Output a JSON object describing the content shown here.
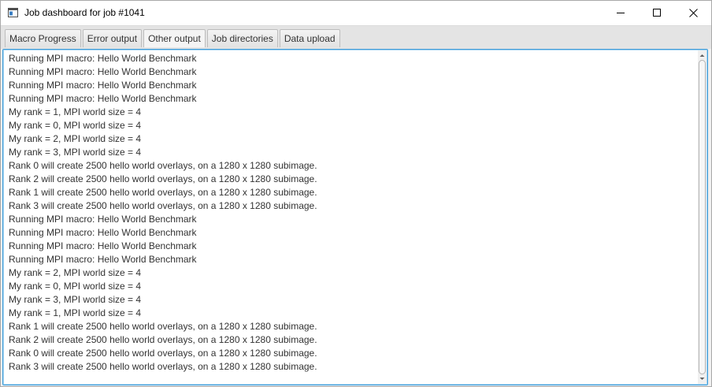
{
  "window": {
    "title": "Job dashboard for job #1041"
  },
  "tabs": [
    {
      "label": "Macro Progress",
      "selected": false
    },
    {
      "label": "Error output",
      "selected": false
    },
    {
      "label": "Other output",
      "selected": true
    },
    {
      "label": "Job directories",
      "selected": false
    },
    {
      "label": "Data upload",
      "selected": false
    }
  ],
  "output": {
    "lines": [
      "Running MPI macro: Hello World Benchmark",
      "Running MPI macro: Hello World Benchmark",
      "Running MPI macro: Hello World Benchmark",
      "Running MPI macro: Hello World Benchmark",
      "My rank = 1, MPI world size = 4",
      "My rank = 0, MPI world size = 4",
      "My rank = 2, MPI world size = 4",
      "My rank = 3, MPI world size = 4",
      "Rank 0 will create 2500 hello world overlays, on a 1280 x 1280 subimage.",
      "Rank 2 will create 2500 hello world overlays, on a 1280 x 1280 subimage.",
      "Rank 1 will create 2500 hello world overlays, on a 1280 x 1280 subimage.",
      "Rank 3 will create 2500 hello world overlays, on a 1280 x 1280 subimage.",
      "Running MPI macro: Hello World Benchmark",
      "Running MPI macro: Hello World Benchmark",
      "Running MPI macro: Hello World Benchmark",
      "Running MPI macro: Hello World Benchmark",
      "My rank = 2, MPI world size = 4",
      "My rank = 0, MPI world size = 4",
      "My rank = 3, MPI world size = 4",
      "My rank = 1, MPI world size = 4",
      "Rank 1 will create 2500 hello world overlays, on a 1280 x 1280 subimage.",
      "Rank 2 will create 2500 hello world overlays, on a 1280 x 1280 subimage.",
      "Rank 0 will create 2500 hello world overlays, on a 1280 x 1280 subimage.",
      "Rank 3 will create 2500 hello world overlays, on a 1280 x 1280 subimage."
    ]
  },
  "icons": {
    "app": "window-app-icon",
    "minimize": "minimize-icon",
    "maximize": "maximize-icon",
    "close": "close-icon"
  },
  "colors": {
    "focus_border": "#3d9bd8",
    "text": "#333333"
  }
}
